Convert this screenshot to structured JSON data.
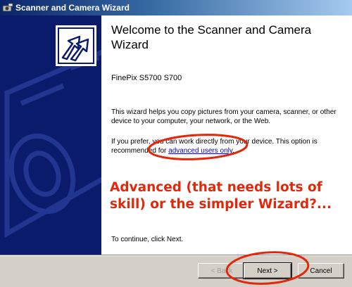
{
  "window": {
    "title": "Scanner and Camera Wizard"
  },
  "main": {
    "heading": "Welcome to the Scanner and Camera Wizard",
    "device_name": "FinePix S5700 S700",
    "description": "This wizard helps you copy pictures from your camera, scanner, or other device to your computer, your network, or the Web.",
    "preference_text": "If you prefer, you can work directly from your device. This option is recommended for ",
    "preference_link": "advanced users only",
    "preference_end": ".",
    "annotation": "Advanced (that needs lots of skill) or the simpler Wizard?...",
    "continue_text": "To continue, click Next."
  },
  "buttons": {
    "back": "< Back",
    "next": "Next >",
    "cancel": "Cancel"
  },
  "colors": {
    "sidebar": "#0b1b6b",
    "annotation": "#e3270a",
    "link": "#0000cc"
  },
  "icons": {
    "title": "scanner-camera-icon",
    "logo": "wizard-arrows-icon"
  }
}
